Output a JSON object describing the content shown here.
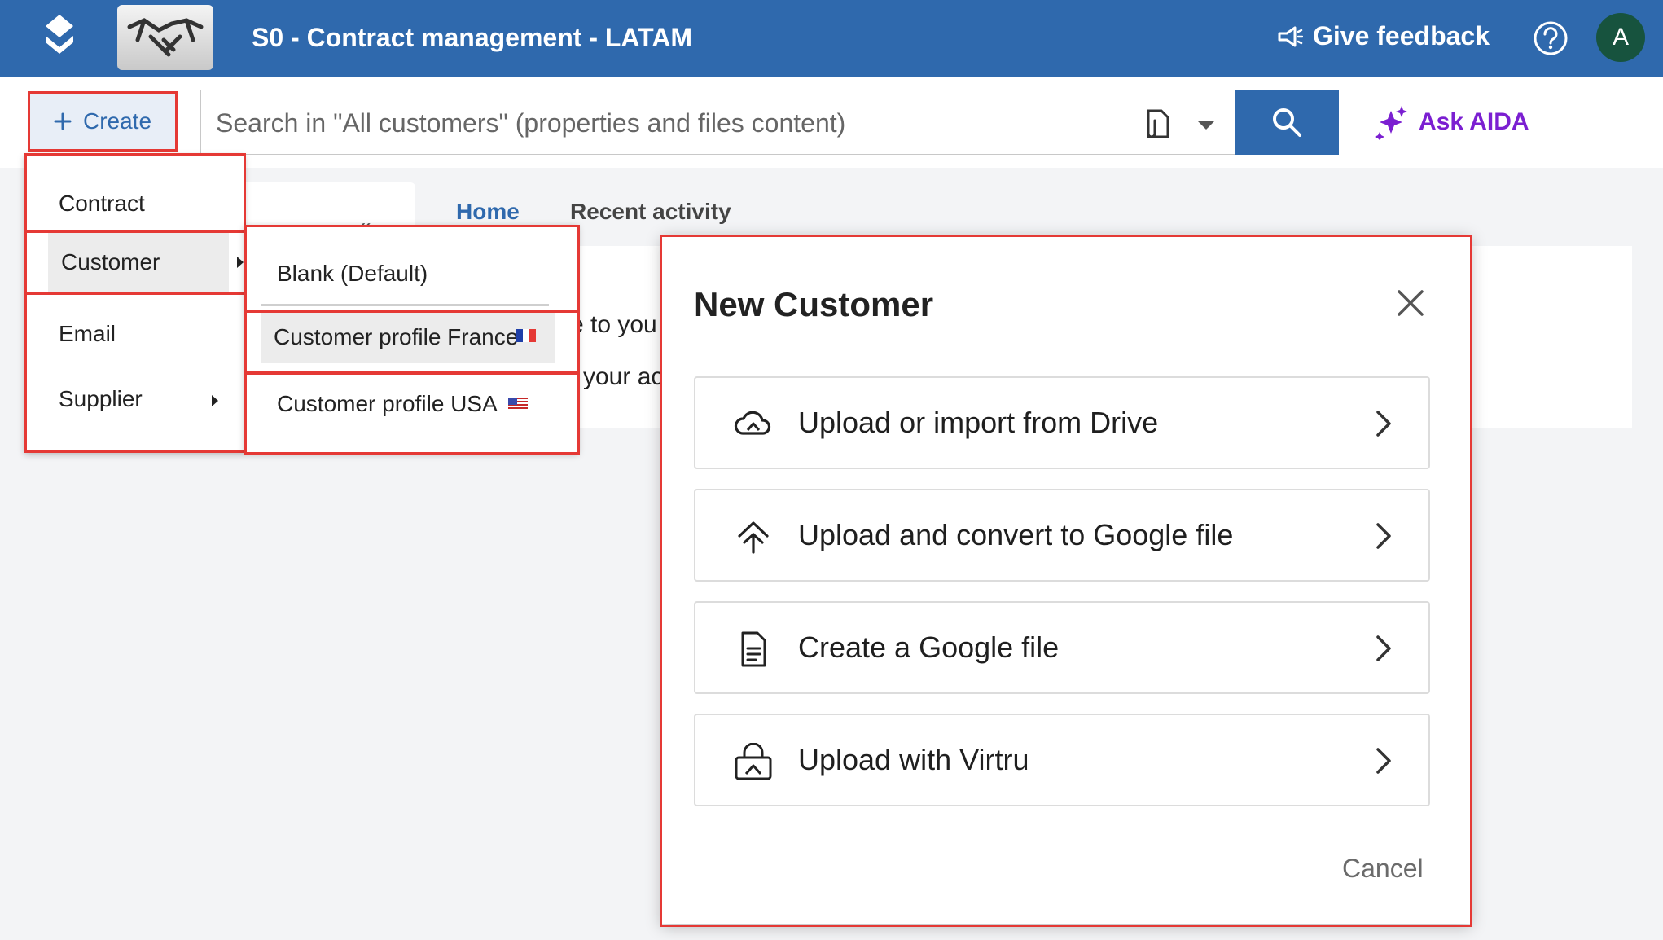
{
  "header": {
    "app_title": "S0 - Contract management - LATAM",
    "feedback_label": "Give feedback",
    "avatar_initial": "A"
  },
  "toolbar": {
    "create_label": "Create",
    "search_placeholder": "Search in \"All customers\" (properties and files content)",
    "ask_aida_label": "Ask AIDA"
  },
  "tabs": [
    {
      "label": "Home",
      "active": true
    },
    {
      "label": "Recent activity",
      "active": false
    }
  ],
  "background_text": {
    "line1": "e to you",
    "line2": "your ac"
  },
  "create_menu": {
    "items": [
      {
        "label": "Contract",
        "has_submenu": false
      },
      {
        "label": "Customer",
        "has_submenu": true
      },
      {
        "label": "Email",
        "has_submenu": false
      },
      {
        "label": "Supplier",
        "has_submenu": true
      }
    ]
  },
  "customer_submenu": {
    "items": [
      {
        "label": "Blank (Default)"
      },
      {
        "label": "Customer profile France",
        "flag": "flag-france-icon"
      },
      {
        "label": "Customer profile USA",
        "flag": "flag-usa-icon"
      }
    ]
  },
  "dialog": {
    "title": "New Customer",
    "options": [
      {
        "label": "Upload or import from Drive",
        "icon": "cloud-drive-icon"
      },
      {
        "label": "Upload and convert to Google file",
        "icon": "upload-arrows-icon"
      },
      {
        "label": "Create a Google file",
        "icon": "document-icon"
      },
      {
        "label": "Upload with Virtru",
        "icon": "virtru-lock-icon"
      }
    ],
    "cancel_label": "Cancel"
  },
  "colors": {
    "header_bg": "#2f69ad",
    "accent_blue": "#2f69ad",
    "aida_purple": "#7b1fd1",
    "highlight_red": "#e53935",
    "avatar_bg": "#17533e"
  }
}
